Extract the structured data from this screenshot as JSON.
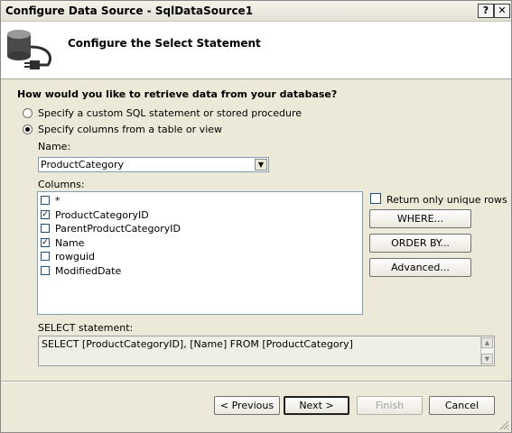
{
  "window": {
    "title": "Configure Data Source - SqlDataSource1",
    "help_label": "?",
    "close_label": "✕"
  },
  "header": {
    "title": "Configure the Select Statement"
  },
  "question": "How would you like to retrieve data from your database?",
  "options": {
    "custom_sql": "Specify a custom SQL statement or stored procedure",
    "table_view": "Specify columns from a table or view",
    "selected": "table_view"
  },
  "name_label": "Name:",
  "name_value": "ProductCategory",
  "columns_label": "Columns:",
  "columns": [
    {
      "label": "*",
      "checked": false
    },
    {
      "label": "ProductCategoryID",
      "checked": true
    },
    {
      "label": "ParentProductCategoryID",
      "checked": false
    },
    {
      "label": "Name",
      "checked": true
    },
    {
      "label": "rowguid",
      "checked": false
    },
    {
      "label": "ModifiedDate",
      "checked": false
    }
  ],
  "unique_rows_label": "Return only unique rows",
  "buttons": {
    "where": "WHERE...",
    "order_by": "ORDER BY...",
    "advanced": "Advanced...",
    "previous": "< Previous",
    "next": "Next >",
    "finish": "Finish",
    "cancel": "Cancel"
  },
  "select_statement_label": "SELECT statement:",
  "select_statement": "SELECT [ProductCategoryID], [Name] FROM [ProductCategory]",
  "icons": {
    "database": "database-plug-icon",
    "dropdown": "chevron-down-icon",
    "scroll_up": "scroll-up-icon",
    "scroll_down": "scroll-down-icon",
    "resize": "resize-grip-icon"
  }
}
